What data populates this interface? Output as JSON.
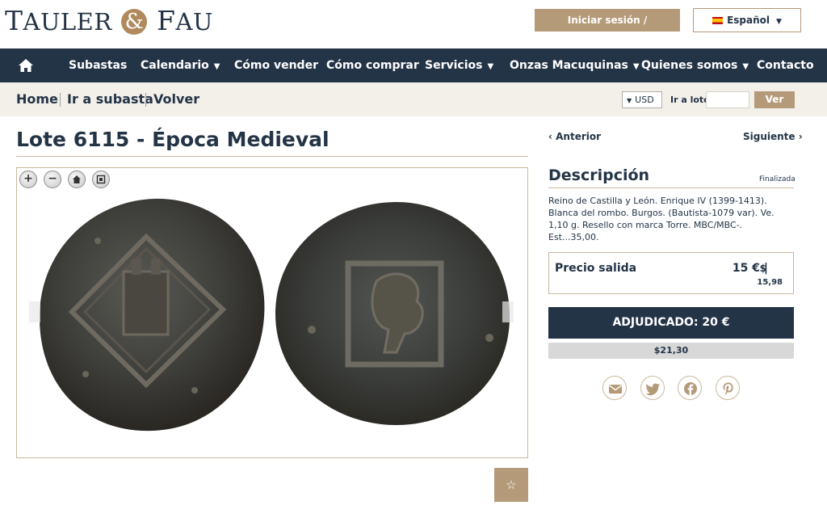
{
  "brand": {
    "part1_initial": "T",
    "part1_rest": "AULER",
    "amp": "&",
    "part2_initial": "F",
    "part2_rest": "AU"
  },
  "header": {
    "login_label": "Iniciar sesión / Registrarse",
    "language_label": "Español"
  },
  "nav": {
    "items": [
      {
        "label": "Subastas",
        "dropdown": false
      },
      {
        "label": "Calendario",
        "dropdown": true
      },
      {
        "label": "Cómo vender",
        "dropdown": false
      },
      {
        "label": "Cómo comprar",
        "dropdown": false
      },
      {
        "label": "Servicios",
        "dropdown": true
      },
      {
        "label": "Onzas Macuquinas",
        "dropdown": true
      },
      {
        "label": "Quienes somos",
        "dropdown": true
      },
      {
        "label": "Contacto",
        "dropdown": false
      }
    ]
  },
  "breadcrumb": {
    "home": "Home",
    "auction": "Ir a subasta",
    "back": "Volver"
  },
  "tools": {
    "currency": "USD",
    "goto_label": "Ir a lote",
    "goto_value": "",
    "goto_button": "Ver"
  },
  "lot": {
    "title": "Lote 6115 - Época Medieval",
    "prev_label": "Anterior",
    "next_label": "Siguiente",
    "description_title": "Descripción",
    "status": "Finalizada",
    "description": "Reino de Castilla y León. Enrique IV (1399-1413). Blanca del rombo. Burgos. (Bautista-1079 var). Ve. 1,10 g. Resello con marca Torre. MBC/MBC-. Est...35,00.",
    "start_price_label": "Precio salida",
    "start_price_eur": "15 € |",
    "start_price_usd_symbol": "$",
    "start_price_usd": "15,98",
    "sold_label": "ADJUDICADO: 20 €",
    "sold_usd": "$21,30"
  },
  "viewer": {
    "zoom_in": "+",
    "zoom_out": "−"
  },
  "colors": {
    "navy": "#243447",
    "gold": "#b59a79",
    "cream": "#f3efe9"
  }
}
